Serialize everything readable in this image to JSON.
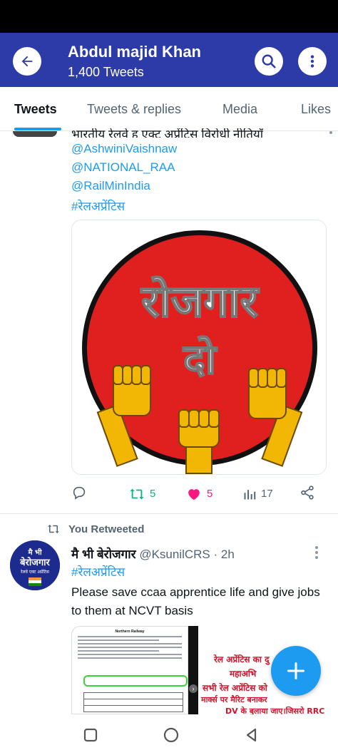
{
  "header": {
    "title": "Abdul majid Khan",
    "subtitle": "1,400 Tweets",
    "bg_color": "#2c3ba8",
    "icons": {
      "back": "arrow-left-icon",
      "search": "search-icon",
      "more": "more-vertical-icon"
    }
  },
  "tabs": [
    {
      "label": "Tweets",
      "active": true
    },
    {
      "label": "Tweets & replies",
      "active": false
    },
    {
      "label": "Media",
      "active": false
    },
    {
      "label": "Likes",
      "active": false
    }
  ],
  "tweet1": {
    "cut_text": "भारतीय रेलवे ह एक्ट अप्रेंटिस विरोधी नीतियाँ",
    "mentions": [
      "@AshwiniVaishnaw",
      "@NATIONAL_RAA",
      "@RailMinIndia"
    ],
    "hashtag": "#रेलअप्रेंटिस",
    "image": {
      "line1": "रोजगार",
      "line2": "दो",
      "circle_color": "#e01f1f",
      "fist_color": "#f2b705"
    },
    "actions": {
      "reply": {
        "icon": "reply-icon",
        "count": ""
      },
      "retweet": {
        "icon": "retweet-icon",
        "count": "5",
        "color": "#00ba7c"
      },
      "like": {
        "icon": "heart-icon",
        "count": "5",
        "color": "#f91880"
      },
      "views": {
        "icon": "views-icon",
        "count": "17"
      },
      "share": {
        "icon": "share-icon",
        "count": ""
      }
    }
  },
  "retweet_banner": {
    "icon": "retweet-icon",
    "text": "You Retweeted"
  },
  "tweet2": {
    "display_name": "मै भी बेरोजगार",
    "handle": "@KsunilCRS",
    "time": "· 2h",
    "hashtag": "#रेलअप्रेंटिस",
    "body": "Please save ccaa apprentice life and give jobs to them  at NCVT basis",
    "avatar": {
      "line1": "मै भी",
      "line2": "बेरोजगार",
      "line3": "रेलवे एक्ट अप्रेंटिस"
    },
    "doc_title": "Northern Railway",
    "red_card_lines": [
      "रेल अप्रेंटिस का दु",
      "महाअभि",
      "सभी रेल अप्रेंटिस को",
      "मार्क्स पर मैरिट बनाकर",
      "DV के बुलाया जाए।जिसरो RRC की"
    ]
  },
  "fab": {
    "icon": "plus-icon",
    "color": "#1d9bf0"
  },
  "navbar": {
    "icons": [
      "recents-square-icon",
      "home-circle-icon",
      "back-triangle-icon"
    ]
  }
}
